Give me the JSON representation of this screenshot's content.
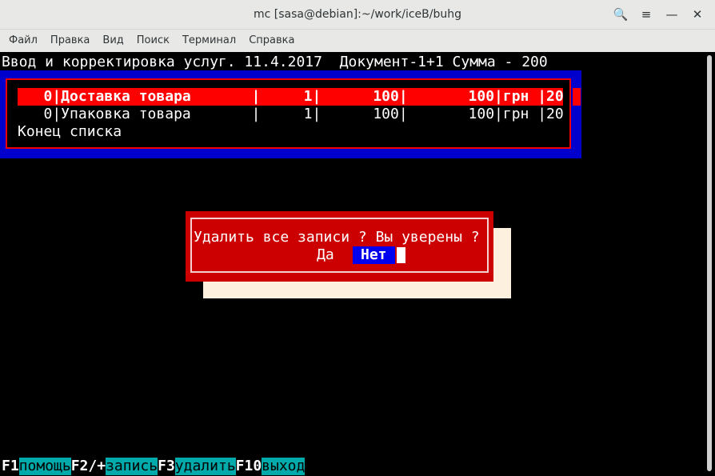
{
  "window": {
    "title": "mc [sasa@debian]:~/work/iceB/buhg",
    "controls": [
      "🔍",
      "≡",
      "—",
      "✕"
    ]
  },
  "menu": {
    "items": [
      "Файл",
      "Правка",
      "Вид",
      "Поиск",
      "Терминал",
      "Справка"
    ]
  },
  "terminal": {
    "header": "Ввод и корректировка услуг. 11.4.2017  Документ-1+1 Сумма - 200",
    "rows": [
      {
        "text": "   0|Доставка товара       |     1|      100|       100|грн |20",
        "selected": true
      },
      {
        "text": "   0|Упаковка товара       |     1|      100|       100|грн |20",
        "selected": false
      }
    ],
    "end_of_list": "Конец списка"
  },
  "dialog": {
    "message": "Удалить все записи ? Вы уверены ?",
    "yes_label": "Да",
    "no_label": "Нет"
  },
  "fkeys": [
    {
      "key": "F1",
      "label": "помощь"
    },
    {
      "key": "F2/+",
      "label": "запись"
    },
    {
      "key": "F3",
      "label": "удалить"
    },
    {
      "key": "F10",
      "label": "выход"
    }
  ],
  "colors": {
    "list_frame": "#0000cc",
    "selected_row": "#ff0000",
    "dialog_bg": "#cc0000",
    "dialog_shadow": "#fdf0de",
    "button_focus": "#0000ee",
    "fkey_label": "#00aaaa"
  }
}
